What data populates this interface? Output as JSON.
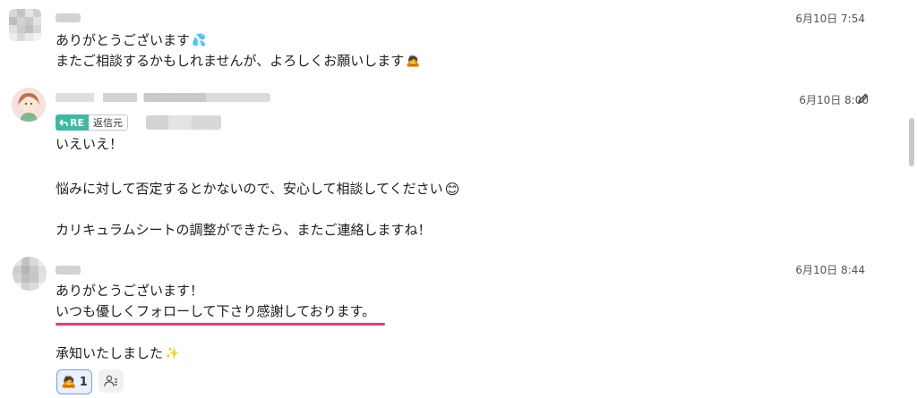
{
  "messages": [
    {
      "timestamp": "6月10日 7:54",
      "lines": [
        "ありがとうございます",
        "またご相談するかもしれませんが、よろしくお願いします"
      ],
      "emojis": [
        "💦",
        "🙇"
      ]
    },
    {
      "timestamp": "6月10日 8:00",
      "reply_badge": {
        "label": "RE",
        "text": "返信元"
      },
      "lines": [
        "いえいえ！",
        "悩みに対して否定するとかないので、安心して相談してください",
        "カリキュラムシートの調整ができたら、またご連絡しますね！"
      ],
      "emojis": [
        "😊"
      ]
    },
    {
      "timestamp": "6月10日 8:44",
      "lines": [
        "ありがとうございます！",
        "いつも優しくフォローして下さり感謝しております。",
        "承知いたしました"
      ],
      "emojis": [
        "✨"
      ],
      "reaction": {
        "emoji": "🙇",
        "count": "1"
      }
    }
  ],
  "colors": {
    "underline": "#e8397a",
    "reply_badge": "#3fb8a6",
    "reaction_border": "#7a9be6",
    "reaction_bg": "#e9f0ff"
  },
  "icons": [
    "edit-pencil-icon",
    "add-reaction-icon",
    "reply-arrow-icon"
  ]
}
